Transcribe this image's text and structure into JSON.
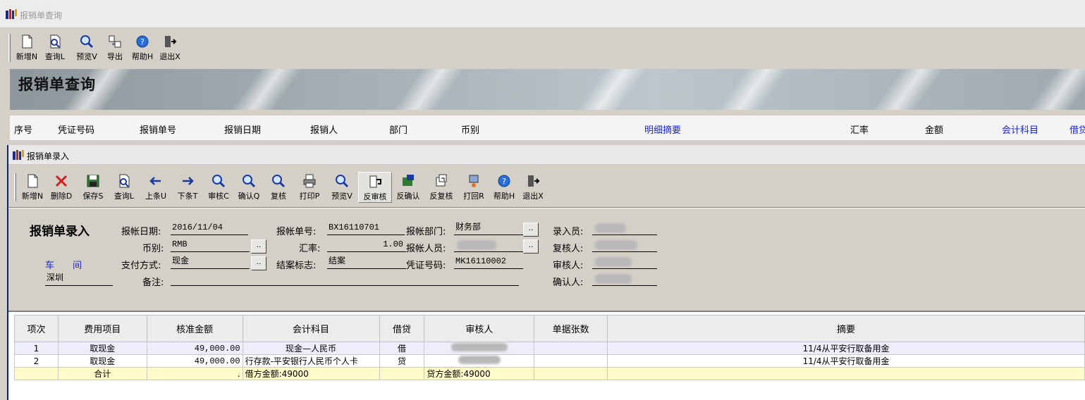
{
  "outer_window": {
    "title": "报销单查询"
  },
  "outer_toolbar": [
    "新增N",
    "查询L",
    "预览V",
    "导出",
    "帮助H",
    "退出X"
  ],
  "banner_title": "报销单查询",
  "list_columns": [
    "序号",
    "凭证号码",
    "报销单号",
    "报销日期",
    "报销人",
    "部门",
    "币别",
    "明细摘要",
    "汇率",
    "金额",
    "会计科目",
    "借贷"
  ],
  "inner_window": {
    "title": "报销单录入"
  },
  "inner_toolbar": [
    "新增N",
    "删除D",
    "保存S",
    "查询L",
    "上条U",
    "下条T",
    "审核C",
    "确认Q",
    "复核",
    "打印P",
    "预览V",
    "反审核",
    "反确认",
    "反复核",
    "打回R",
    "帮助H",
    "退出X"
  ],
  "form": {
    "title": "报销单录入",
    "date_label": "报帐日期:",
    "date_value": "2016/11/04",
    "bill_no_label": "报帐单号:",
    "bill_no_value": "BX16110701",
    "dept_label": "报帐部门:",
    "dept_value": "财务部",
    "entry_label": "录入员:",
    "currency_label": "币别:",
    "currency_value": "RMB",
    "rate_label": "汇率:",
    "rate_value": "1.00",
    "person_label": "报帐人员:",
    "reviewer_label": "复核人:",
    "workshop_label": "车　　间",
    "location_value": "深圳",
    "pay_label": "支付方式:",
    "pay_value": "现金",
    "closed_label": "结案标志:",
    "closed_value": "结案",
    "voucher_label": "凭证号码:",
    "voucher_value": "MK16110002",
    "auditor_label": "审核人:",
    "remark_label": "备注:",
    "confirm_label": "确认人:",
    "dots": ".."
  },
  "grid": {
    "columns": [
      "项次",
      "费用项目",
      "核准金额",
      "会计科目",
      "借贷",
      "审核人",
      "单据张数",
      "摘要"
    ],
    "rows": [
      [
        "1",
        "取现金",
        "49,000.00",
        "现金—人民币",
        "借",
        "",
        "",
        "11/4从平安行取备用金"
      ],
      [
        "2",
        "取现金",
        "49,000.00",
        "行存款-平安银行人民币个人卡",
        "贷",
        "",
        "",
        "11/4从平安行取备用金"
      ]
    ],
    "total": {
      "label": "合计",
      "amount": ".",
      "debit": "借方金额:49000",
      "credit": "贷方金额:49000"
    }
  },
  "colors": {
    "title_bar": "#ececec",
    "window": "#d4d0c8",
    "blue_text": "#1a24e0",
    "selected_row": "#eeeefa",
    "total_row": "#fffbc8"
  }
}
